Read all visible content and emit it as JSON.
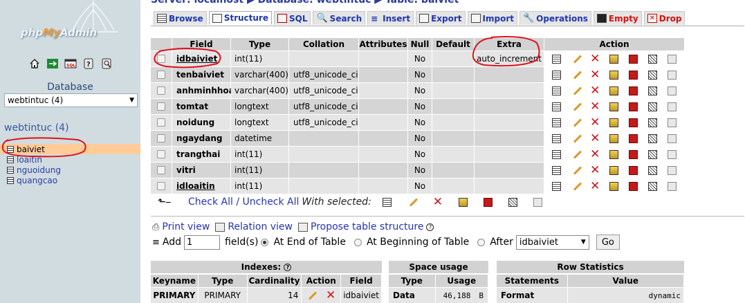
{
  "breadcrumb": {
    "server": "Server: localhost",
    "database": "Database: webtintuc",
    "table": "Table: baiviet"
  },
  "sidebar": {
    "logo_php": "php",
    "logo_my": "My",
    "logo_admin": "Admin",
    "database_label": "Database",
    "database_select": "webtintuc (4)",
    "db_title": "webtintuc (4)",
    "tables": [
      "baiviet",
      "loaitin",
      "nguoidung",
      "quangcao"
    ]
  },
  "tabs": [
    {
      "label": "Browse"
    },
    {
      "label": "Structure"
    },
    {
      "label": "SQL"
    },
    {
      "label": "Search"
    },
    {
      "label": "Insert"
    },
    {
      "label": "Export"
    },
    {
      "label": "Import"
    },
    {
      "label": "Operations"
    },
    {
      "label": "Empty"
    },
    {
      "label": "Drop"
    }
  ],
  "structure": {
    "headers": {
      "field": "Field",
      "type": "Type",
      "collation": "Collation",
      "attributes": "Attributes",
      "null": "Null",
      "default": "Default",
      "extra": "Extra",
      "action": "Action"
    },
    "rows": [
      {
        "field": "idbaiviet",
        "type": "int(11)",
        "collation": "",
        "null": "No",
        "default": "",
        "extra": "auto_increment"
      },
      {
        "field": "tenbaiviet",
        "type": "varchar(400)",
        "collation": "utf8_unicode_ci",
        "null": "No",
        "default": "",
        "extra": ""
      },
      {
        "field": "anhminhhoa",
        "type": "varchar(400)",
        "collation": "utf8_unicode_ci",
        "null": "No",
        "default": "",
        "extra": ""
      },
      {
        "field": "tomtat",
        "type": "longtext",
        "collation": "utf8_unicode_ci",
        "null": "No",
        "default": "",
        "extra": ""
      },
      {
        "field": "noidung",
        "type": "longtext",
        "collation": "utf8_unicode_ci",
        "null": "No",
        "default": "",
        "extra": ""
      },
      {
        "field": "ngaydang",
        "type": "datetime",
        "collation": "",
        "null": "No",
        "default": "",
        "extra": ""
      },
      {
        "field": "trangthai",
        "type": "int(11)",
        "collation": "",
        "null": "No",
        "default": "",
        "extra": ""
      },
      {
        "field": "vitri",
        "type": "int(11)",
        "collation": "",
        "null": "No",
        "default": "",
        "extra": ""
      },
      {
        "field": "idloaitin",
        "type": "int(11)",
        "collation": "",
        "null": "No",
        "default": "",
        "extra": ""
      }
    ]
  },
  "bulk": {
    "check_all": "Check All",
    "separator": " / ",
    "uncheck_all": "Uncheck All",
    "with_selected": "With selected:"
  },
  "links": {
    "print_view": "Print view",
    "relation_view": "Relation view",
    "propose": "Propose table structure"
  },
  "add_fields": {
    "add_label": "Add",
    "count": "1",
    "fields_label": "field(s)",
    "opt_end": "At End of Table",
    "opt_begin": "At Beginning of Table",
    "opt_after": "After",
    "after_select": "idbaiviet",
    "go": "Go"
  },
  "indexes": {
    "title": "Indexes:",
    "headers": [
      "Keyname",
      "Type",
      "Cardinality",
      "Action",
      "Field"
    ],
    "rows": [
      {
        "keyname": "PRIMARY",
        "type": "PRIMARY",
        "cardinality": "14",
        "field": "idbaiviet"
      }
    ]
  },
  "space_usage": {
    "title": "Space usage",
    "headers": [
      "Type",
      "Usage"
    ],
    "rows": [
      {
        "type": "Data",
        "usage": "46,188",
        "unit": "B"
      }
    ]
  },
  "row_stats": {
    "title": "Row Statistics",
    "headers": [
      "Statements",
      "Value"
    ],
    "rows": [
      {
        "statement": "Format",
        "value": "dynamic"
      }
    ]
  },
  "colors": {
    "sidebar_bg": "#d0dce0",
    "active_table": "#ffcc99",
    "link": "#2432b8",
    "annotation_red": "#e0101a"
  }
}
